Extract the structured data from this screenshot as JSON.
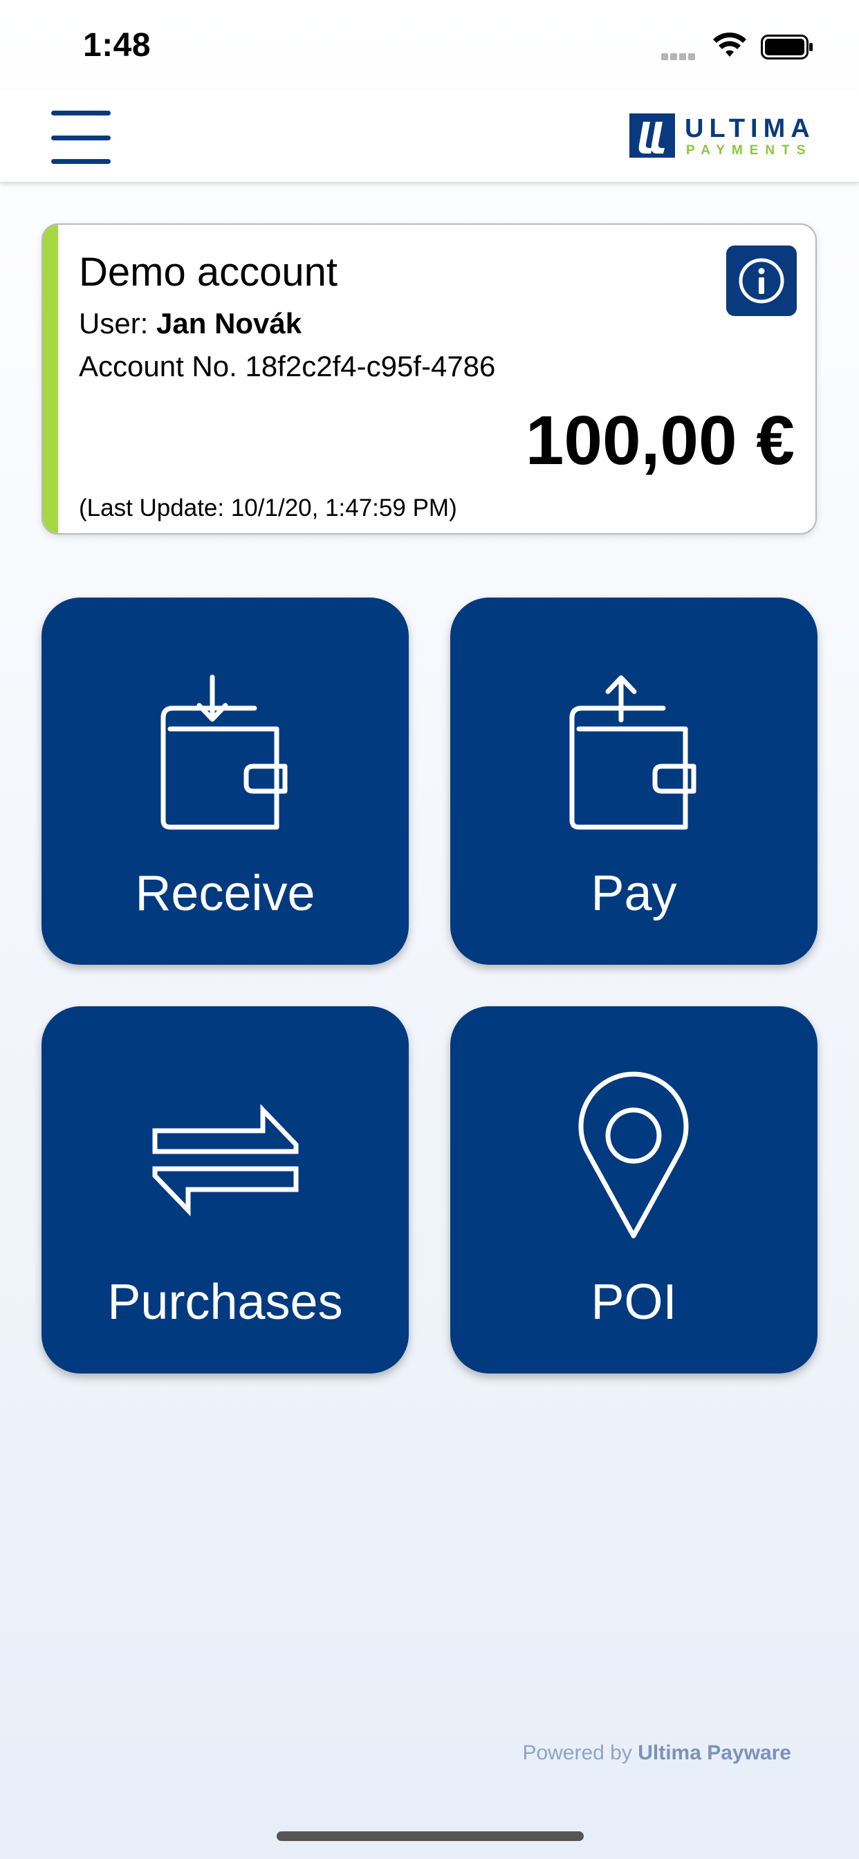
{
  "status_bar": {
    "time": "1:48"
  },
  "header": {
    "logo_word": "ULTIMA",
    "logo_sub": "PAYMENTS",
    "brand_color": "#0a3a7e",
    "accent_color": "#8cc63f"
  },
  "account": {
    "title": "Demo account",
    "user_label": "User:",
    "user_name": "Jan Novák",
    "account_number_label": "Account No.",
    "account_number": "18f2c2f4-c95f-4786",
    "balance": "100,00 €",
    "last_update": "(Last Update: 10/1/20, 1:47:59 PM)"
  },
  "tiles": [
    {
      "label": "Receive",
      "icon": "wallet-receive-icon"
    },
    {
      "label": "Pay",
      "icon": "wallet-pay-icon"
    },
    {
      "label": "Purchases",
      "icon": "transfer-arrows-icon"
    },
    {
      "label": "POI",
      "icon": "map-pin-icon"
    }
  ],
  "footer": {
    "powered_by_label": "Powered by",
    "powered_by_name": "Ultima Payware"
  }
}
